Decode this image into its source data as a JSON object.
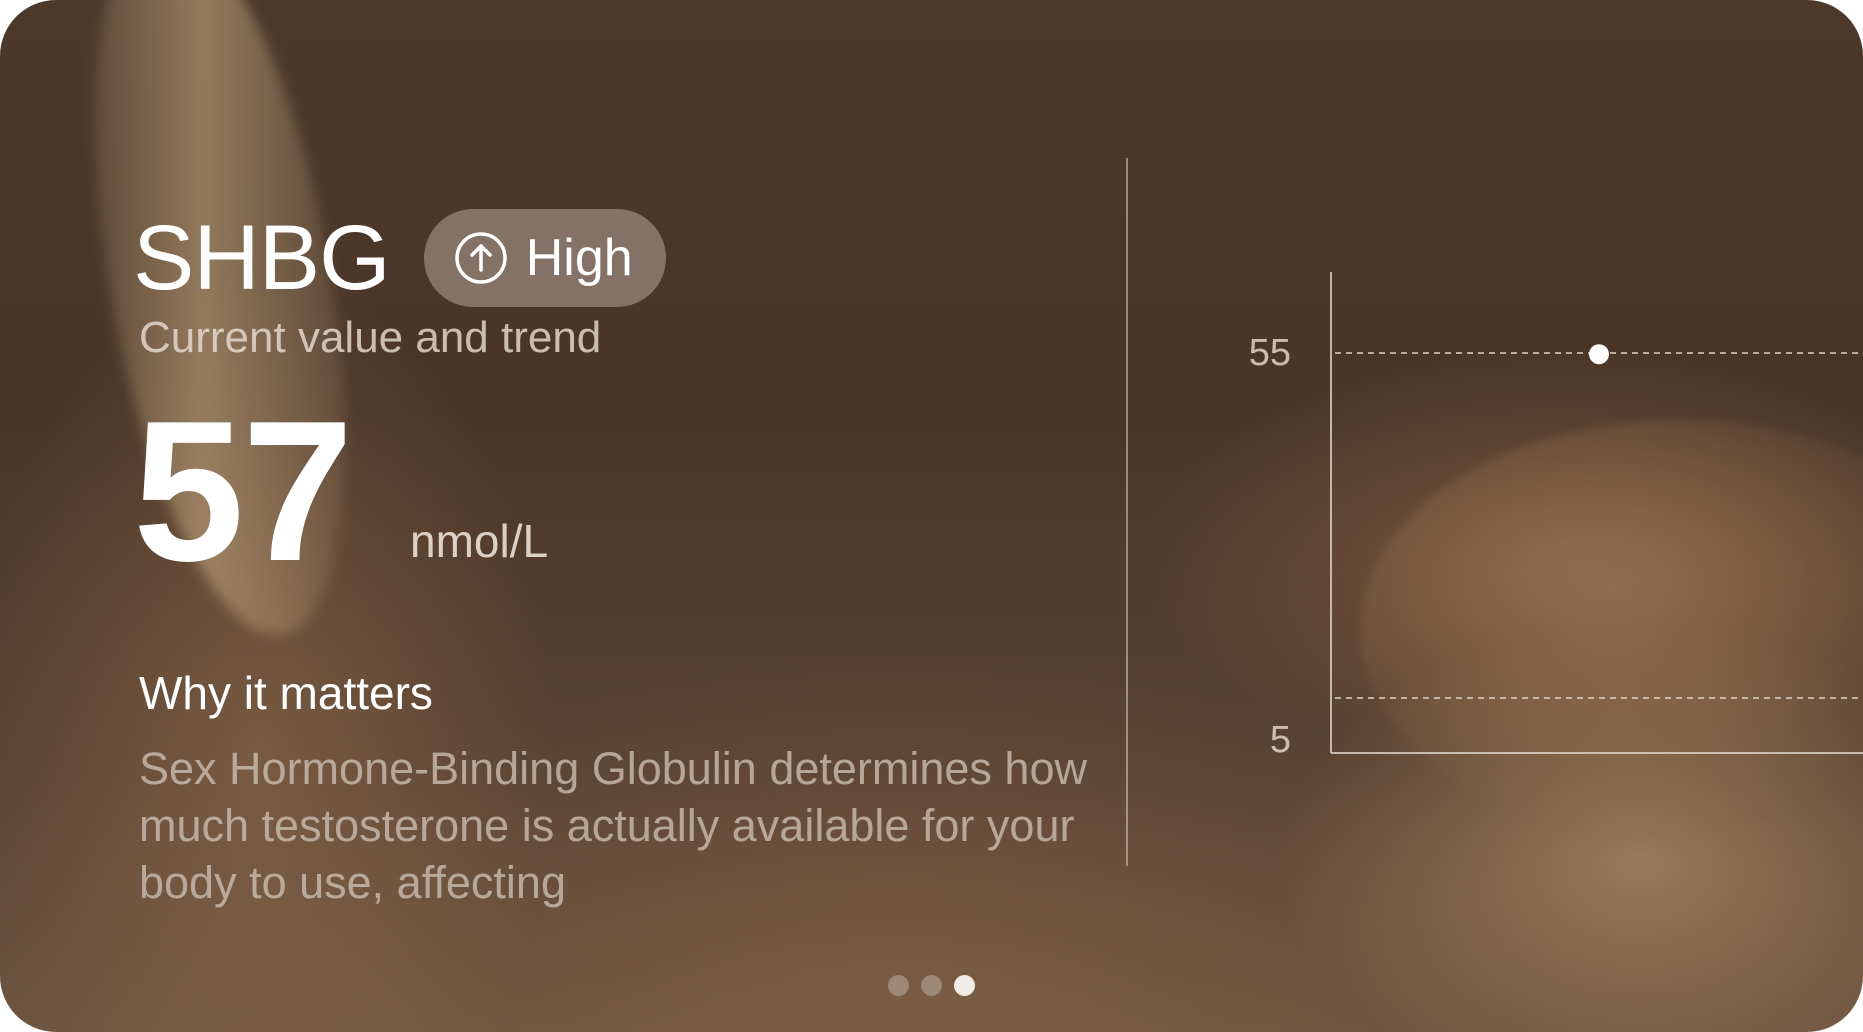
{
  "card": {
    "title": "SHBG",
    "status": {
      "label": "High",
      "icon": "arrow-up-circle-icon"
    },
    "subtitle": "Current value and trend",
    "value": "57",
    "unit": "nmol/L",
    "why_heading": "Why it matters",
    "why_body": "Sex Hormone-Binding Globulin determines how much testosterone is actually available for your body to use, affecting"
  },
  "chart_data": {
    "type": "scatter",
    "y_ticks": [
      "55",
      "5"
    ],
    "reference_lines": [
      55,
      5
    ],
    "points": [
      {
        "y": 57
      }
    ]
  },
  "pagination": {
    "count": 3,
    "active": 2
  },
  "colors": {
    "accent_text": "#ffffff",
    "pill_background": "#aa968c",
    "background": "#4d392b"
  }
}
